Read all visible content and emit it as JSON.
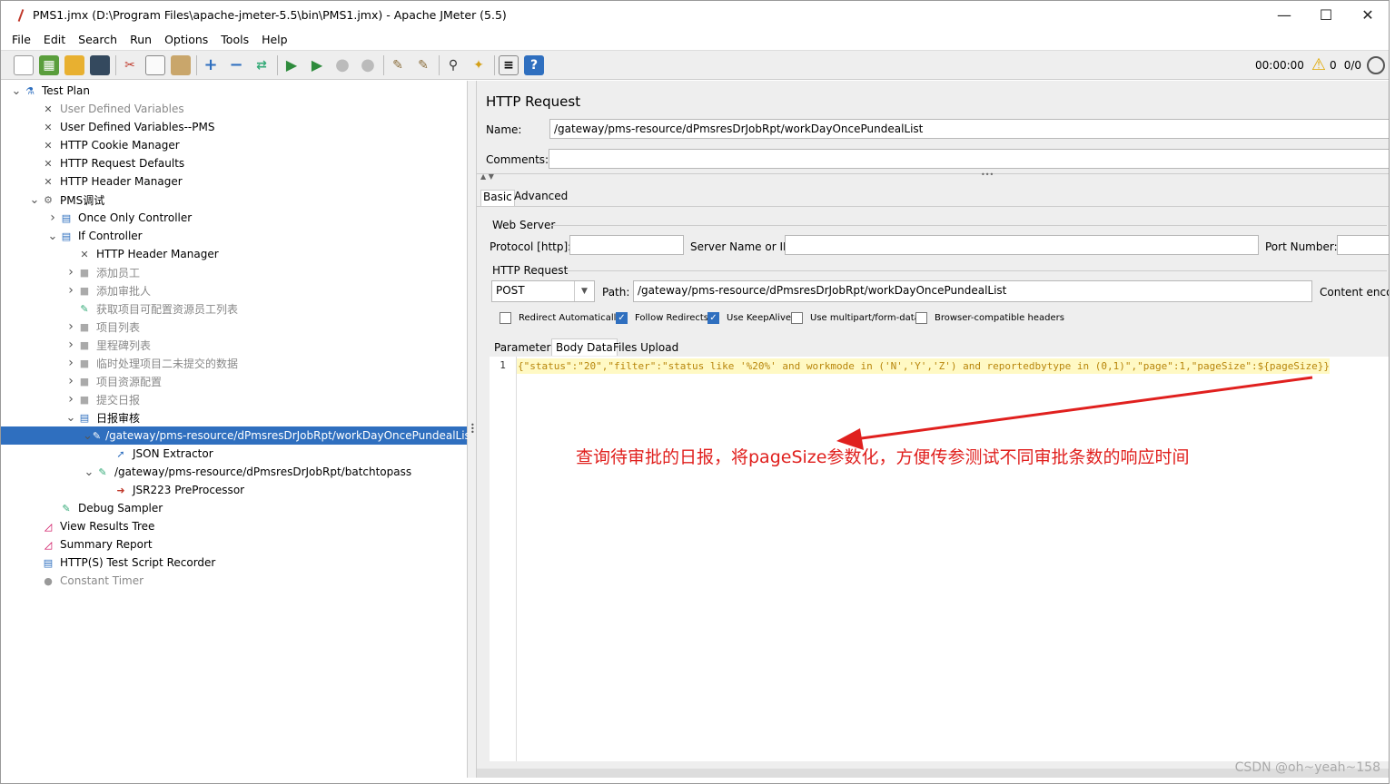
{
  "window": {
    "title": "PMS1.jmx (D:\\Program Files\\apache-jmeter-5.5\\bin\\PMS1.jmx) - Apache JMeter (5.5)",
    "minimize": "—",
    "maximize": "☐",
    "close": "✕"
  },
  "menu": [
    "File",
    "Edit",
    "Search",
    "Run",
    "Options",
    "Tools",
    "Help"
  ],
  "toolbar": {
    "timer": "00:00:00",
    "warnings": "0",
    "threads": "0/0"
  },
  "tree": [
    {
      "label": "Test Plan",
      "indent": 0,
      "twisty": "v",
      "icon": "flask-icon",
      "gray": false
    },
    {
      "label": "User Defined Variables",
      "indent": 1,
      "twisty": "",
      "icon": "wrench-icon",
      "gray": true
    },
    {
      "label": "User Defined Variables--PMS",
      "indent": 1,
      "twisty": "",
      "icon": "wrench-icon",
      "gray": false
    },
    {
      "label": "HTTP Cookie Manager",
      "indent": 1,
      "twisty": "",
      "icon": "wrench-icon",
      "gray": false
    },
    {
      "label": "HTTP Request Defaults",
      "indent": 1,
      "twisty": "",
      "icon": "wrench-icon",
      "gray": false
    },
    {
      "label": "HTTP Header Manager",
      "indent": 1,
      "twisty": "",
      "icon": "wrench-icon",
      "gray": false
    },
    {
      "label": "PMS调试",
      "indent": 1,
      "twisty": "v",
      "icon": "gear-icon",
      "gray": false
    },
    {
      "label": "Once Only Controller",
      "indent": 2,
      "twisty": ">",
      "icon": "controller-icon",
      "gray": false
    },
    {
      "label": "If Controller",
      "indent": 2,
      "twisty": "v",
      "icon": "controller-icon",
      "gray": false
    },
    {
      "label": "HTTP Header Manager",
      "indent": 3,
      "twisty": "",
      "icon": "wrench-icon",
      "gray": false
    },
    {
      "label": "添加员工",
      "indent": 3,
      "twisty": ">",
      "icon": "disabled-icon",
      "gray": true
    },
    {
      "label": "添加审批人",
      "indent": 3,
      "twisty": ">",
      "icon": "disabled-icon",
      "gray": true
    },
    {
      "label": "获取项目可配置资源员工列表",
      "indent": 3,
      "twisty": "",
      "icon": "pipette-icon",
      "gray": true
    },
    {
      "label": "项目列表",
      "indent": 3,
      "twisty": ">",
      "icon": "disabled-icon",
      "gray": true
    },
    {
      "label": "里程碑列表",
      "indent": 3,
      "twisty": ">",
      "icon": "disabled-icon",
      "gray": true
    },
    {
      "label": "临时处理项目二未提交的数据",
      "indent": 3,
      "twisty": ">",
      "icon": "disabled-icon",
      "gray": true
    },
    {
      "label": "项目资源配置",
      "indent": 3,
      "twisty": ">",
      "icon": "disabled-icon",
      "gray": true
    },
    {
      "label": "提交日报",
      "indent": 3,
      "twisty": ">",
      "icon": "disabled-icon",
      "gray": true
    },
    {
      "label": "日报审核",
      "indent": 3,
      "twisty": "v",
      "icon": "controller-icon",
      "gray": false
    },
    {
      "label": "/gateway/pms-resource/dPmsresDrJobRpt/workDayOncePundealList",
      "indent": 4,
      "twisty": "v",
      "icon": "pipette-icon",
      "gray": false,
      "selected": true
    },
    {
      "label": "JSON Extractor",
      "indent": 5,
      "twisty": "",
      "icon": "extractor-icon",
      "gray": false
    },
    {
      "label": "/gateway/pms-resource/dPmsresDrJobRpt/batchtopass",
      "indent": 4,
      "twisty": "v",
      "icon": "pipette-icon",
      "gray": false
    },
    {
      "label": "JSR223 PreProcessor",
      "indent": 5,
      "twisty": "",
      "icon": "preprocessor-icon",
      "gray": false
    },
    {
      "label": "Debug Sampler",
      "indent": 2,
      "twisty": "",
      "icon": "pipette-icon",
      "gray": false
    },
    {
      "label": "View Results Tree",
      "indent": 1,
      "twisty": "",
      "icon": "graph-icon",
      "gray": false
    },
    {
      "label": "Summary Report",
      "indent": 1,
      "twisty": "",
      "icon": "graph-icon",
      "gray": false
    },
    {
      "label": "HTTP(S) Test Script Recorder",
      "indent": 1,
      "twisty": "",
      "icon": "recorder-icon",
      "gray": false
    },
    {
      "label": "Constant Timer",
      "indent": 1,
      "twisty": "",
      "icon": "timer-icon",
      "gray": true
    }
  ],
  "panel": {
    "title": "HTTP Request",
    "name_label": "Name:",
    "name_value": "/gateway/pms-resource/dPmsresDrJobRpt/workDayOncePundealList",
    "comments_label": "Comments:",
    "tab_basic": "Basic",
    "tab_advanced": "Advanced",
    "web_server": "Web Server",
    "protocol_label": "Protocol [http]:",
    "server_label": "Server Name or IP:",
    "port_label": "Port Number:",
    "http_request": "HTTP Request",
    "method": "POST",
    "path_label": "Path:",
    "path_value": "/gateway/pms-resource/dPmsresDrJobRpt/workDayOncePundealList",
    "content_encoding": "Content encod",
    "checks": [
      {
        "label": "Redirect Automatically",
        "checked": false
      },
      {
        "label": "Follow Redirects",
        "checked": true
      },
      {
        "label": "Use KeepAlive",
        "checked": true
      },
      {
        "label": "Use multipart/form-data",
        "checked": false
      },
      {
        "label": "Browser-compatible headers",
        "checked": false
      }
    ],
    "subtab_parameters": "Parameters",
    "subtab_body": "Body Data",
    "subtab_files": "Files Upload",
    "line_number": "1",
    "body_line": "{\"status\":\"20\",\"filter\":\"status like '%20%' and workmode in ('N','Y','Z') and reportedbytype in (0,1)\",\"page\":1,\"pageSize\":${pageSize}}"
  },
  "annotation": "查询待审批的日报，将pageSize参数化，方便传参测试不同审批条数的响应时间",
  "watermark": "CSDN @oh~yeah~158"
}
